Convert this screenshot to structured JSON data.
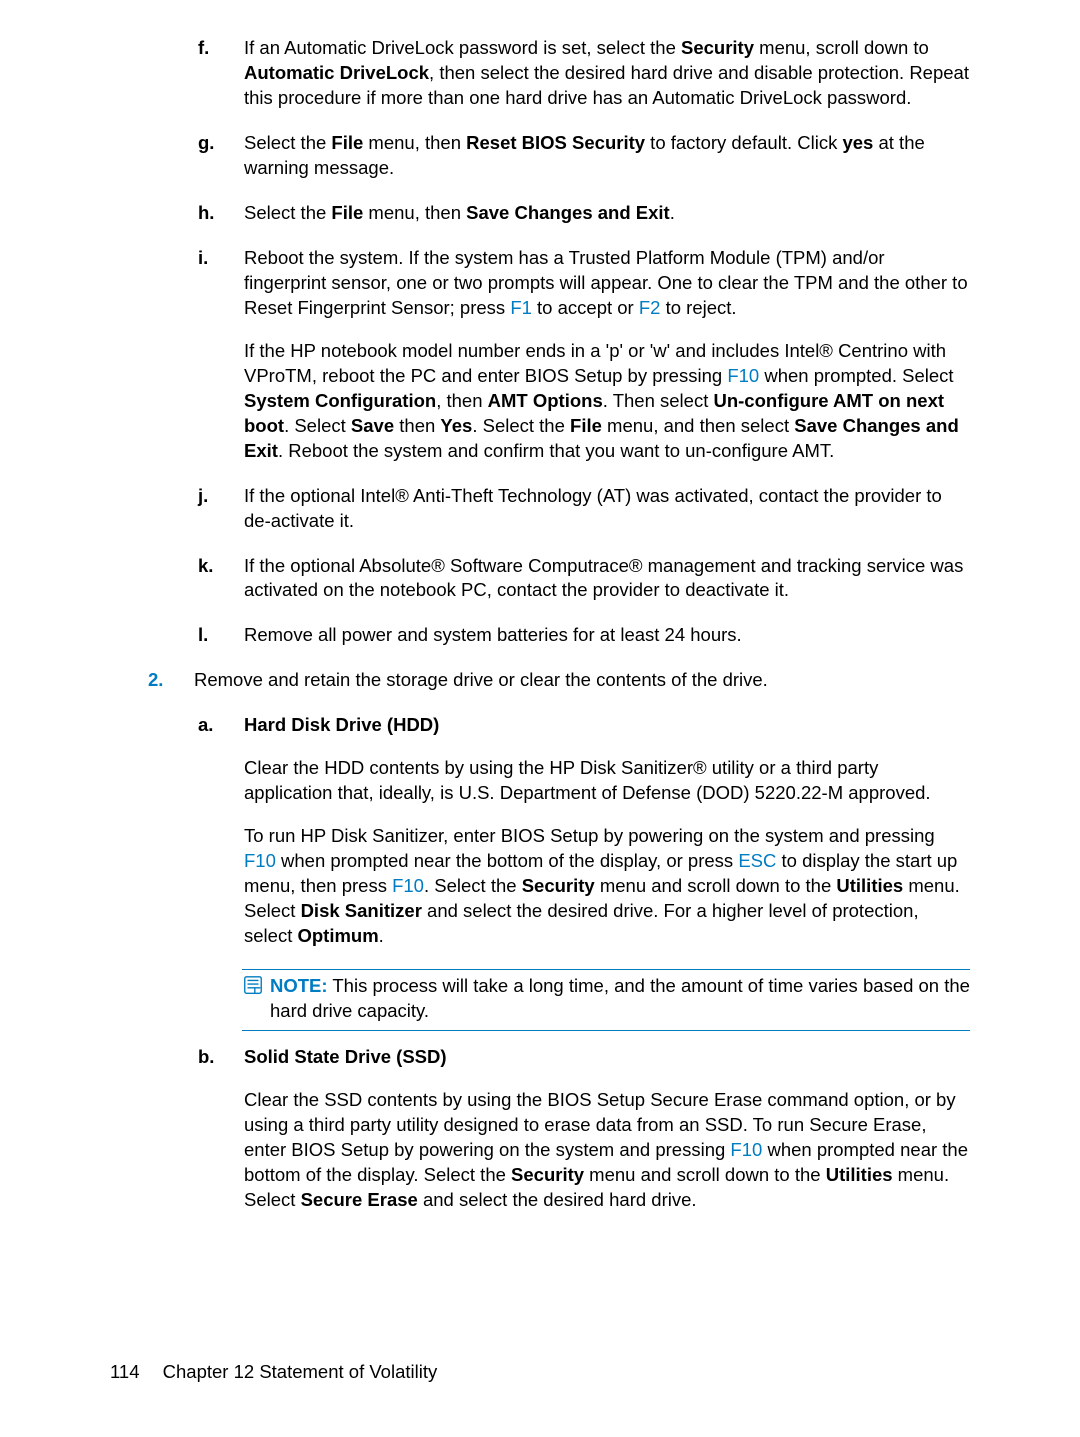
{
  "items": {
    "f": {
      "marker": "f.",
      "text_parts": [
        "If an Automatic DriveLock password is set, select the ",
        "Security",
        " menu, scroll down to ",
        "Automatic DriveLock",
        ", then select the desired hard drive and disable protection. Repeat this procedure if more than one hard drive has an Automatic DriveLock password."
      ]
    },
    "g": {
      "marker": "g.",
      "text_parts": [
        "Select the ",
        "File",
        " menu, then ",
        "Reset BIOS Security",
        " to factory default. Click ",
        "yes",
        " at the warning message."
      ]
    },
    "h": {
      "marker": "h.",
      "text_parts": [
        "Select the ",
        "File",
        " menu, then ",
        "Save Changes and Exit",
        "."
      ]
    },
    "i": {
      "marker": "i.",
      "para1_parts": [
        "Reboot the system. If the system has a Trusted Platform Module (TPM) and/or fingerprint sensor, one or two prompts will appear. One to clear the TPM and the other to Reset Fingerprint Sensor; press ",
        "F1",
        " to accept or ",
        "F2",
        " to reject."
      ],
      "para2_parts": [
        "If the HP notebook model number ends in a 'p' or 'w' and includes Intel® Centrino with VProTM, reboot the PC and enter BIOS Setup by pressing ",
        "F10",
        " when prompted. Select ",
        "System Configuration",
        ", then ",
        "AMT Options",
        ". Then select ",
        "Un-configure AMT on next boot",
        ". Select ",
        "Save",
        " then ",
        "Yes",
        ". Select the ",
        "File",
        " menu, and then select ",
        "Save Changes and Exit",
        ". Reboot the system and confirm that you want to un-configure AMT."
      ]
    },
    "j": {
      "marker": "j.",
      "text": "If the optional Intel® Anti-Theft Technology (AT) was activated, contact the provider to de-activate it."
    },
    "k": {
      "marker": "k.",
      "text": "If the optional Absolute® Software Computrace® management and tracking service was activated on the notebook PC, contact the provider to deactivate it."
    },
    "l": {
      "marker": "l.",
      "text": "Remove all power and system batteries for at least 24 hours."
    },
    "n2": {
      "marker": "2.",
      "text": "Remove and retain the storage drive or clear the contents of the drive."
    },
    "a": {
      "marker": "a.",
      "heading": "Hard Disk Drive (HDD)",
      "para1": "Clear the HDD contents by using the HP Disk Sanitizer® utility or a third party application that, ideally, is U.S. Department of Defense (DOD) 5220.22-M approved.",
      "para2_parts": [
        "To run HP Disk Sanitizer, enter BIOS Setup by powering on the system and pressing ",
        "F10",
        " when prompted near the bottom of the display, or press ",
        "ESC",
        " to display the start up menu, then press ",
        "F10",
        ". Select the ",
        "Security",
        " menu and scroll down to the ",
        "Utilities",
        " menu. Select ",
        "Disk Sanitizer",
        " and select the desired drive. For a higher level of protection, select ",
        "Optimum",
        "."
      ]
    },
    "note": {
      "label": "NOTE:",
      "text": "This process will take a long time, and the amount of time varies based on the hard drive capacity."
    },
    "b": {
      "marker": "b.",
      "heading": "Solid State Drive (SSD)",
      "para_parts": [
        "Clear the SSD contents by using the BIOS Setup Secure Erase command option, or by using a third party utility designed to erase data from an SSD. To run Secure Erase, enter BIOS Setup by powering on the system and pressing ",
        "F10",
        " when prompted near the bottom of the display. Select the ",
        "Security",
        " menu and scroll down to the ",
        "Utilities",
        " menu. Select ",
        "Secure Erase",
        " and select the desired hard drive."
      ]
    }
  },
  "footer": {
    "page": "114",
    "chapter": "Chapter 12   Statement of Volatility"
  }
}
